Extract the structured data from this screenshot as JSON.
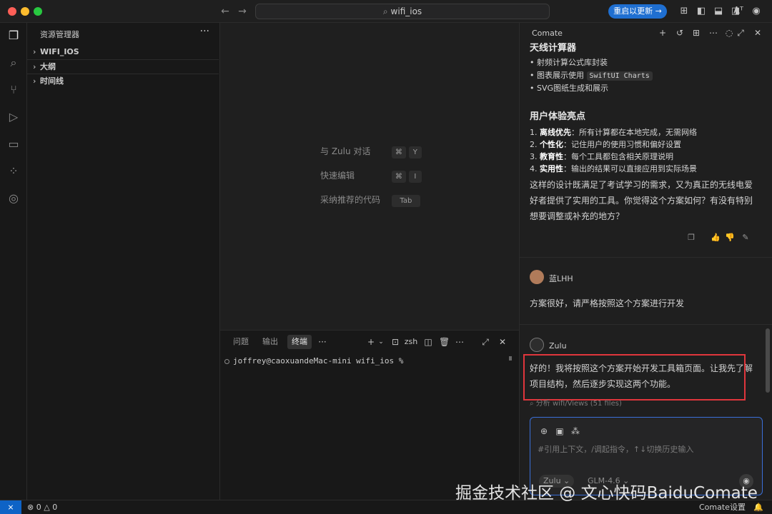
{
  "titlebar": {
    "search_text": "wifi_ios",
    "update_button": "重启以更新 →",
    "icons": [
      "layout-icon",
      "sidebar-left-icon",
      "panel-icon",
      "sidebar-right-icon",
      "font-icon",
      "account-icon"
    ]
  },
  "activitybar": {
    "items": [
      "explorer-icon",
      "search-icon",
      "source-control-icon",
      "run-debug-icon",
      "remote-explorer-icon",
      "extensions-icon",
      "browser-icon"
    ]
  },
  "explorer": {
    "title": "资源管理器",
    "more": "···",
    "items": [
      {
        "label": "WIFI_IOS"
      },
      {
        "label": "大纲"
      },
      {
        "label": "时间线"
      }
    ]
  },
  "editor": {
    "hints": [
      {
        "label": "与 Zulu 对话",
        "keys": [
          "⌘",
          "Y"
        ]
      },
      {
        "label": "快速编辑",
        "keys": [
          "⌘",
          "I"
        ]
      },
      {
        "label": "采纳推荐的代码",
        "keys": [
          "Tab"
        ]
      }
    ]
  },
  "panel": {
    "tabs": [
      "问题",
      "输出",
      "终端"
    ],
    "active_tab": "终端",
    "more": "···",
    "shell_label": "zsh",
    "terminal_prompt": "joffrey@caoxuandeMac-mini wifi_ios %"
  },
  "comate": {
    "title": "Comate",
    "section1_title": "天线计算器",
    "section1_items": [
      {
        "text": "射频计算公式库封装"
      },
      {
        "prefix": "图表展示使用 ",
        "code": "SwiftUI Charts"
      },
      {
        "text": "SVG图纸生成和展示"
      }
    ],
    "section2_title": "用户体验亮点",
    "section2_items": [
      {
        "num": "1.",
        "bold": "离线优先",
        "rest": "：所有计算都在本地完成，无需网络"
      },
      {
        "num": "2.",
        "bold": "个性化",
        "rest": "：记住用户的使用习惯和偏好设置"
      },
      {
        "num": "3.",
        "bold": "教育性",
        "rest": "：每个工具都包含相关原理说明"
      },
      {
        "num": "4.",
        "bold": "实用性",
        "rest": "：输出的结果可以直接应用到实际场景"
      }
    ],
    "summary_lines": [
      "这样的设计既满足了考试学习的需求，又为真正的无线电爱",
      "好者提供了实用的工具。你觉得这个方案如何？有没有特别",
      "想要调整或补充的地方？"
    ],
    "user_name": "蓝LHH",
    "user_message": "方案很好，请严格按照这个方案进行开发",
    "bot_name": "Zulu",
    "bot_message_lines": [
      "好的！我将按照这个方案开始开发工具箱页面。让我先了解",
      "项目结构，然后逐步实现这两个功能。"
    ],
    "analysis_text": "分析 wifi/Views (51 files)",
    "input_placeholder": "#引用上下文，/调起指令，↑↓切换历史输入",
    "agent_chip": "Zulu ⌄",
    "model_label": "GLM-4.6 ⌄",
    "highlight_color": "#e0363c"
  },
  "statusbar": {
    "errors": "0",
    "warnings": "0",
    "right_label": "Comate设置"
  },
  "watermark": "掘金技术社区 @ 文心快码BaiduComate"
}
